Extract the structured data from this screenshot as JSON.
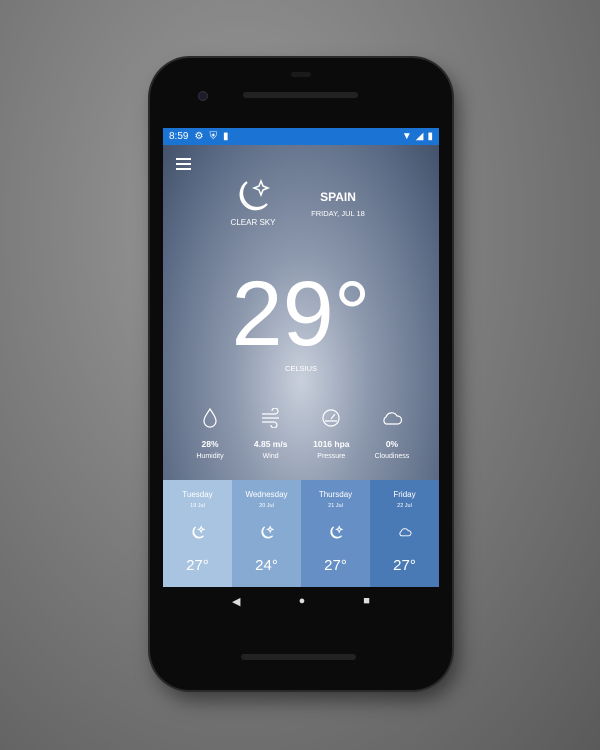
{
  "status_bar": {
    "time": "8:59",
    "icons": [
      "gear-icon",
      "shield-icon",
      "sd-card-icon"
    ],
    "right_icons": [
      "wifi-icon",
      "signal-icon",
      "battery-icon"
    ]
  },
  "weather": {
    "condition": "CLEAR SKY",
    "location": "SPAIN",
    "date": "FRIDAY, JUL 18",
    "temperature": "29°",
    "unit": "CELSIUS"
  },
  "stats": [
    {
      "value": "28%",
      "label": "Humidity",
      "icon": "droplet-icon"
    },
    {
      "value": "4.85 m/s",
      "label": "Wind",
      "icon": "wind-icon"
    },
    {
      "value": "1016 hpa",
      "label": "Pressure",
      "icon": "gauge-icon"
    },
    {
      "value": "0%",
      "label": "Cloudiness",
      "icon": "cloud-icon"
    }
  ],
  "forecast": [
    {
      "day": "Tuesday",
      "date": "19 Jul",
      "temp": "27°",
      "icon": "moon-star-icon",
      "color": "#a9c4e0"
    },
    {
      "day": "Wednesday",
      "date": "20 Jul",
      "temp": "24°",
      "icon": "moon-star-icon",
      "color": "#87aad3"
    },
    {
      "day": "Thursday",
      "date": "21 Jul",
      "temp": "27°",
      "icon": "moon-star-icon",
      "color": "#6690c5"
    },
    {
      "day": "Friday",
      "date": "22 Jul",
      "temp": "27°",
      "icon": "cloud-icon",
      "color": "#4a7ab6"
    }
  ],
  "nav": {
    "back": "◀",
    "home": "●",
    "recents": "■"
  }
}
